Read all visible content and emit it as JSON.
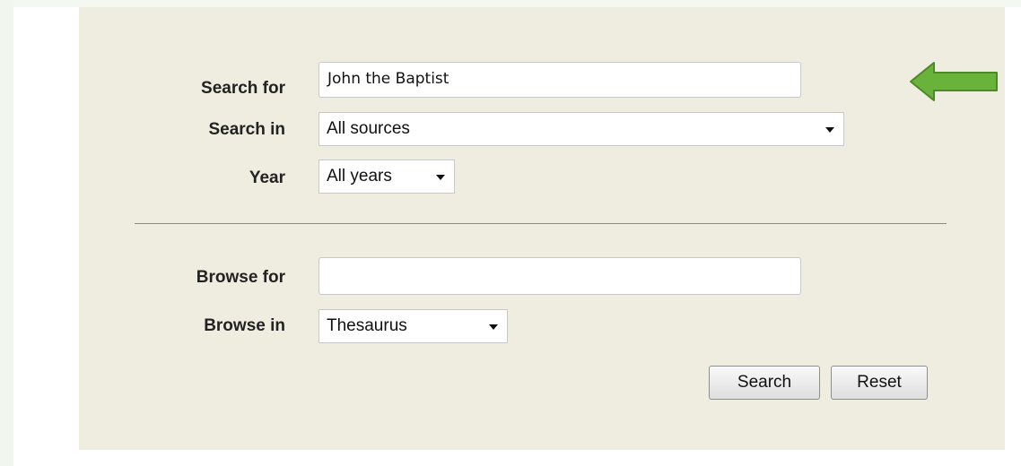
{
  "search_form": {
    "search_for_label": "Search for",
    "search_for_value": "John the Baptist",
    "search_in_label": "Search in",
    "search_in_selected": "All sources",
    "year_label": "Year",
    "year_selected": "All years",
    "browse_for_label": "Browse for",
    "browse_for_value": "",
    "browse_in_label": "Browse in",
    "browse_in_selected": "Thesaurus",
    "search_button": "Search",
    "reset_button": "Reset"
  },
  "colors": {
    "panel_background": "#eeeddf",
    "arrow_fill": "#69b33a",
    "arrow_stroke": "#4c8a25"
  },
  "icons": {
    "pointer": "left-arrow-icon",
    "dropdown": "chevron-down-icon"
  }
}
